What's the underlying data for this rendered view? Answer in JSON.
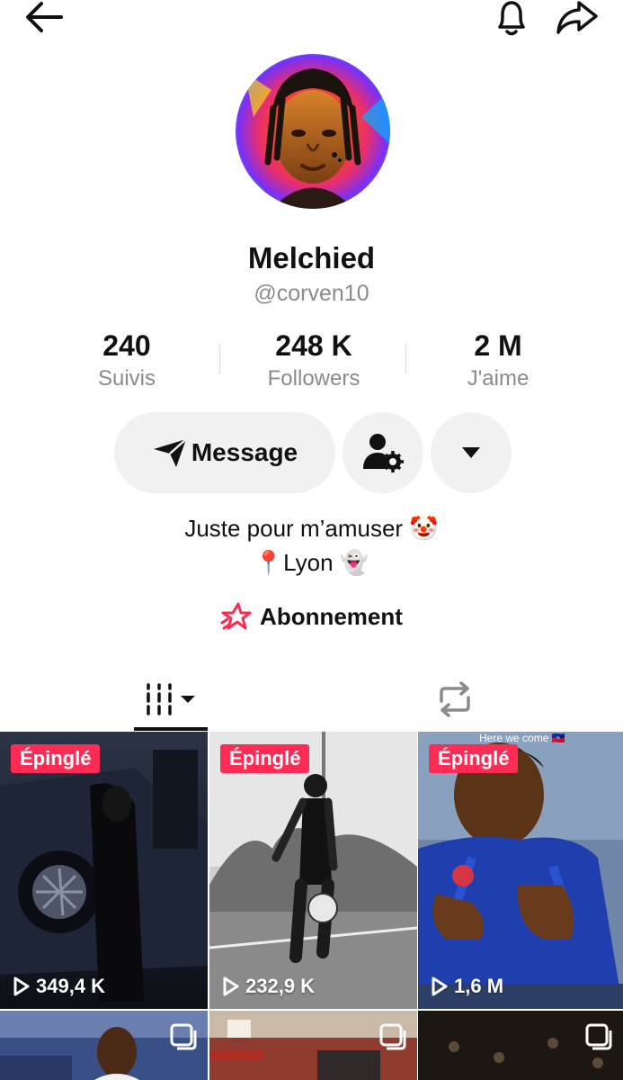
{
  "profile": {
    "display_name": "Melchied",
    "username": "@corven10"
  },
  "stats": [
    {
      "value": "240",
      "label": "Suivis"
    },
    {
      "value": "248 K",
      "label": "Followers"
    },
    {
      "value": "2 M",
      "label": "J'aime"
    }
  ],
  "actions": {
    "message_label": "Message"
  },
  "bio": {
    "line1": "Juste pour m’amuser 🤡",
    "line2": "📍Lyon 👻"
  },
  "subscription": {
    "label": "Abonnement"
  },
  "colors": {
    "accent": "#fe2c55",
    "text": "#161823",
    "muted": "#8a8b91",
    "button_bg": "#f1f1f2"
  },
  "videos": [
    {
      "pinned_label": "Épinglé",
      "views": "349,4 K"
    },
    {
      "pinned_label": "Épinglé",
      "views": "232,9 K"
    },
    {
      "pinned_label": "Épinglé",
      "views": "1,6 M",
      "overlay": "Here we come 🇭🇹"
    }
  ],
  "icons": {
    "back": "arrow-left-icon",
    "notifications": "bell-icon",
    "share": "share-icon",
    "send": "paper-plane-icon",
    "profile_settings": "user-gear-icon",
    "more": "caret-down-icon",
    "subscription": "star-icon",
    "videos_tab": "grid-bars-icon",
    "reposts_tab": "repost-icon",
    "play": "play-icon",
    "multi_photo": "stack-icon"
  }
}
